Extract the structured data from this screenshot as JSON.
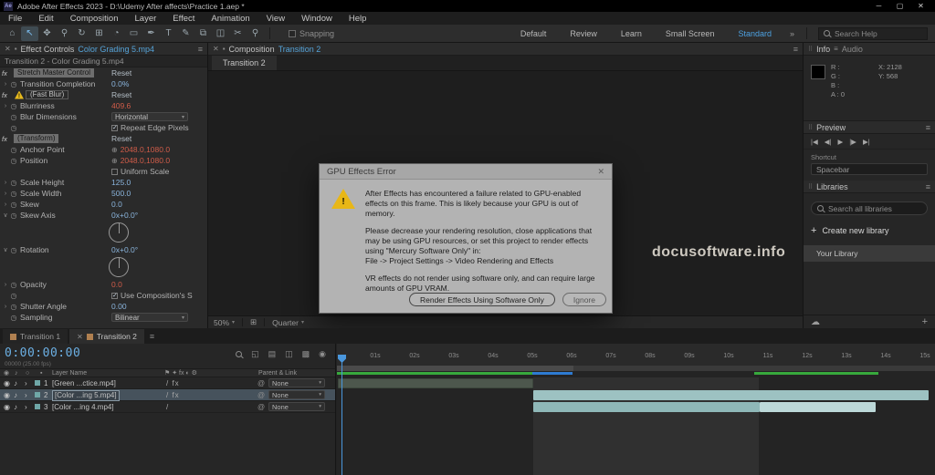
{
  "icons": {
    "app_logo": "Ae",
    "minimize": "─",
    "maximize": "▢",
    "close": "✕",
    "hamburger": "≡",
    "chevrons": "»",
    "chevron_down": "▾",
    "plus": "+",
    "cloud": "☁",
    "stopwatch": "◷",
    "crosshair": "⊕",
    "twirl_closed": "›",
    "twirl_open": "∨",
    "eye": "◉",
    "audio": "♪",
    "solo": "○",
    "label_col": "▪",
    "pickwhip": "@",
    "fx": "fx",
    "warning": "!",
    "check": "✓",
    "panel": "▪",
    "dots": "⠿",
    "viewport_grid": "⊞"
  },
  "window": {
    "title": "Adobe After Effects 2023 - D:\\Udemy After affects\\Practice 1.aep *"
  },
  "menu": {
    "items": [
      "File",
      "Edit",
      "Composition",
      "Layer",
      "Effect",
      "Animation",
      "View",
      "Window",
      "Help"
    ]
  },
  "toolbar": {
    "tools": [
      {
        "name": "home-tool",
        "glyph": "⌂"
      },
      {
        "name": "selection-tool",
        "glyph": "↖",
        "active": true
      },
      {
        "name": "hand-tool",
        "glyph": "✥"
      },
      {
        "name": "zoom-tool",
        "glyph": "⚲"
      },
      {
        "name": "orbit-camera-tool",
        "glyph": "↻"
      },
      {
        "name": "pan-camera-tool",
        "glyph": "⊞"
      },
      {
        "name": "dolly-camera-tool",
        "glyph": "◔"
      },
      {
        "name": "mask-shape-tool",
        "glyph": "▭"
      },
      {
        "name": "pen-tool",
        "glyph": "✒"
      },
      {
        "name": "type-tool",
        "glyph": "T"
      },
      {
        "name": "brush-tool",
        "glyph": "✎"
      },
      {
        "name": "clone-stamp-tool",
        "glyph": "⧉"
      },
      {
        "name": "eraser-tool",
        "glyph": "◫"
      },
      {
        "name": "roto-brush-tool",
        "glyph": "✂"
      },
      {
        "name": "puppet-pin-tool",
        "glyph": "⚲"
      }
    ],
    "snapping": "Snapping",
    "workspaces": [
      "Default",
      "Review",
      "Learn",
      "Small Screen",
      "Standard"
    ],
    "active_workspace": "Standard",
    "search_placeholder": "Search Help"
  },
  "effect_controls": {
    "tab_title": "Effect Controls",
    "comp_name": "Color Grading 5.mp4",
    "breadcrumb": "Transition 2 - Color Grading 5.mp4",
    "rows": [
      {
        "kind": "effect",
        "label": "Stretch Master Control",
        "action": "Reset",
        "style": "filled"
      },
      {
        "kind": "prop",
        "twirl": "closed",
        "label": "Transition Completion",
        "value": "0.0%",
        "color": "blue"
      },
      {
        "kind": "effect",
        "label": "(Fast Blur)",
        "action": "Reset",
        "style": "outline",
        "warning": true
      },
      {
        "kind": "prop",
        "twirl": "closed",
        "label": "Blurriness",
        "value": "409.6",
        "color": "red"
      },
      {
        "kind": "dropdown",
        "label": "Blur Dimensions",
        "value": "Horizontal"
      },
      {
        "kind": "check",
        "label": "Repeat Edge Pixels",
        "checked": true,
        "stopwatch": true
      },
      {
        "kind": "effect",
        "label": "(Transform)",
        "action": "Reset",
        "style": "filled"
      },
      {
        "kind": "prop",
        "label": "Anchor Point",
        "value": "2048.0,1080.0",
        "color": "red",
        "crosshair": true
      },
      {
        "kind": "prop",
        "label": "Position",
        "value": "2048.0,1080.0",
        "color": "red",
        "crosshair": true
      },
      {
        "kind": "check",
        "label": "Uniform Scale",
        "checked": false,
        "stopwatch": false
      },
      {
        "kind": "prop",
        "twirl": "closed",
        "label": "Scale Height",
        "value": "125.0",
        "color": "blue"
      },
      {
        "kind": "prop",
        "twirl": "closed",
        "label": "Scale Width",
        "value": "500.0",
        "color": "blue"
      },
      {
        "kind": "prop",
        "twirl": "closed",
        "label": "Skew",
        "value": "0.0",
        "color": "blue"
      },
      {
        "kind": "prop",
        "twirl": "open",
        "label": "Skew Axis",
        "value": "0x+0.0°",
        "color": "blue"
      },
      {
        "kind": "dial"
      },
      {
        "kind": "prop",
        "twirl": "open",
        "label": "Rotation",
        "value": "0x+0.0°",
        "color": "blue"
      },
      {
        "kind": "dial"
      },
      {
        "kind": "prop",
        "twirl": "closed",
        "label": "Opacity",
        "value": "0.0",
        "color": "red"
      },
      {
        "kind": "check",
        "label": "Use Composition's S",
        "checked": true,
        "stopwatch": true
      },
      {
        "kind": "prop",
        "twirl": "closed",
        "label": "Shutter Angle",
        "value": "0.00",
        "color": "blue"
      },
      {
        "kind": "dropdown",
        "label": "Sampling",
        "value": "Bilinear"
      }
    ]
  },
  "composition": {
    "tab_title": "Composition",
    "comp_name": "Transition 2",
    "tab": "Transition 2",
    "zoom": "50%",
    "resolution": "Quarter"
  },
  "dialog": {
    "title": "GPU Effects Error",
    "p1": "After Effects has encountered a failure related to GPU-enabled effects on this frame. This is likely because your GPU is out of memory.",
    "p2": "Please decrease your rendering resolution, close applications that may be using GPU resources, or set this project to render effects using \"Mercury Software Only\" in:",
    "p3": "File -> Project Settings -> Video Rendering and Effects",
    "p4": "VR effects do not render using software only, and can require large amounts of GPU VRAM.",
    "buttons": [
      "Render Effects Using Software Only",
      "Ignore"
    ]
  },
  "info_panel": {
    "tab_info": "Info",
    "tab_audio": "Audio",
    "channel_lines": [
      "R :",
      "G :",
      "B :",
      "A : 0"
    ],
    "x_label": "X: 2128",
    "y_label": "Y: 568"
  },
  "preview_panel": {
    "title": "Preview",
    "controls": [
      {
        "name": "first-frame-button",
        "glyph": "|◀"
      },
      {
        "name": "previous-frame-button",
        "glyph": "◀|"
      },
      {
        "name": "play-button",
        "glyph": "▶"
      },
      {
        "name": "next-frame-button",
        "glyph": "|▶"
      },
      {
        "name": "last-frame-button",
        "glyph": "▶|"
      }
    ],
    "shortcut_label": "Shortcut",
    "shortcut_value": "Spacebar"
  },
  "libraries": {
    "title": "Libraries",
    "search_placeholder": "Search all libraries",
    "create_label": "Create new library",
    "library_name": "Your Library"
  },
  "watermark": "docusoftware.info",
  "timeline": {
    "tabs": [
      {
        "label": "Transition 1",
        "active": false
      },
      {
        "label": "Transition 2",
        "active": true
      }
    ],
    "timecode": "0:00:00:00",
    "frame_info": "00000 (25.00 fps)",
    "toggles": [
      {
        "name": "composition-mini-flowchart-icon",
        "glyph": "◱"
      },
      {
        "name": "draft-3d-icon",
        "glyph": "▤"
      },
      {
        "name": "shy-layers-icon",
        "glyph": "◫"
      },
      {
        "name": "frame-blending-icon",
        "glyph": "▩"
      },
      {
        "name": "motion-blur-icon",
        "glyph": "◉"
      }
    ],
    "columns": {
      "layer_name": "Layer Name",
      "switches": "⚑ ✦ fx ◐ ⚙",
      "parent_link": "Parent & Link"
    },
    "layers": [
      {
        "num": "1",
        "name": "[Green ...ctice.mp4]",
        "switches": "/ fx",
        "parent": "None",
        "selected": false
      },
      {
        "num": "2",
        "name": "[Color ...ing 5.mp4]",
        "switches": "/ fx",
        "parent": "None",
        "selected": true
      },
      {
        "num": "3",
        "name": "[Color ...ing 4.mp4]",
        "switches": "/",
        "parent": "None",
        "selected": false
      }
    ],
    "ruler_ticks": [
      "01s",
      "02s",
      "03s",
      "04s",
      "05s",
      "06s",
      "07s",
      "08s",
      "09s",
      "10s",
      "11s",
      "12s",
      "13s",
      "14s",
      "15s"
    ]
  },
  "colors": {
    "accent_blue": "#4a97dd",
    "value_blue": "#8ab4dc",
    "value_red": "#d05c49",
    "cache_green": "#37a93c",
    "cache_blue": "#2e7bd2",
    "warning_yellow": "#e8b717",
    "timecode_blue": "#6cb0e4"
  }
}
